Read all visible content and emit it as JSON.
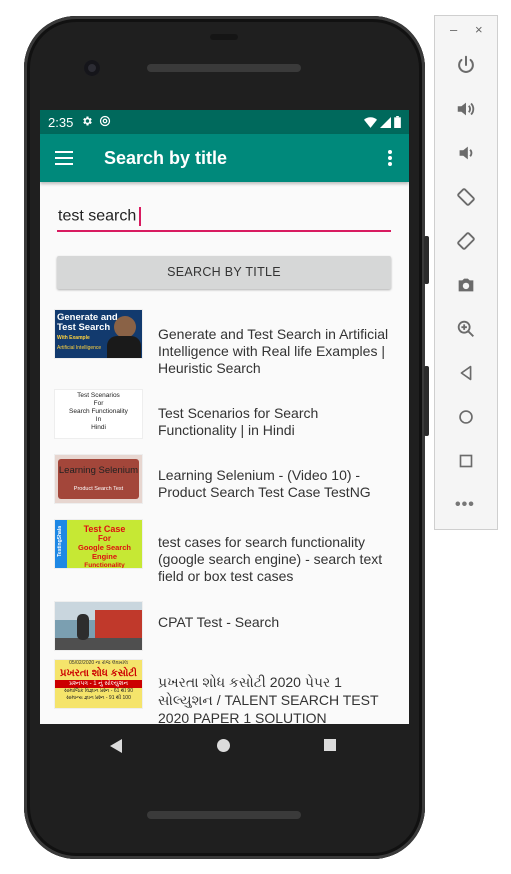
{
  "status_bar": {
    "time": "2:35"
  },
  "app_bar": {
    "title": "Search by title"
  },
  "search": {
    "value": "test search",
    "button_label": "SEARCH BY TITLE"
  },
  "results": [
    {
      "title": "Generate and Test Search in Artificial Intelligence with Real life Examples | Heuristic Search",
      "thumb_lines": [
        "Generate and",
        "Test Search",
        "With Example",
        "Artificial Intelligence"
      ]
    },
    {
      "title": "Test Scenarios for Search Functionality | in Hindi",
      "thumb_lines": [
        "Test Scenarios",
        "For",
        "Search Functionality",
        "In",
        "Hindi"
      ]
    },
    {
      "title": "Learning Selenium - (Video 10) - Product Search Test Case TestNG",
      "thumb_lines": [
        "Learning Selenium",
        "Product Search Test"
      ]
    },
    {
      "title": "test cases for search functionality (google search engine) - search text field or box test cases",
      "thumb_lines": [
        "Test Case",
        "For",
        "Google Search Engine",
        "Functionality",
        "TestingShala"
      ]
    },
    {
      "title": "CPAT Test - Search",
      "thumb_lines": []
    },
    {
      "title": "પ્રખરતા શોધ કસોટી 2020 પેપર 1 સોલ્યુશન / TALENT SEARCH TEST 2020 PAPER 1 SOLUTION",
      "thumb_lines": [
        "05/02/2020 ના રોજ લેવાયેલ",
        "પ્રખરતા શોધ કસોટી",
        "પ્રશ્નપત્ર - 1 નું સોલ્યુશન",
        "સામાજિક વિજ્ઞાન પ્રશ્ન - 61 થી 90",
        "સામાન્ય જ્ઞાન પ્રશ્ન - 91 થી 100"
      ]
    }
  ],
  "emulator_panel": {
    "minimize": "–",
    "close": "×",
    "tools": [
      "power-icon",
      "volume-up-icon",
      "volume-down-icon",
      "rotate-left-icon",
      "rotate-right-icon",
      "camera-icon",
      "zoom-icon",
      "back-icon",
      "home-icon",
      "overview-icon"
    ],
    "more": "•••"
  },
  "colors": {
    "status_bar": "#00695c",
    "app_bar": "#00897b",
    "accent": "#d81b60",
    "button": "#d6d7d7"
  }
}
